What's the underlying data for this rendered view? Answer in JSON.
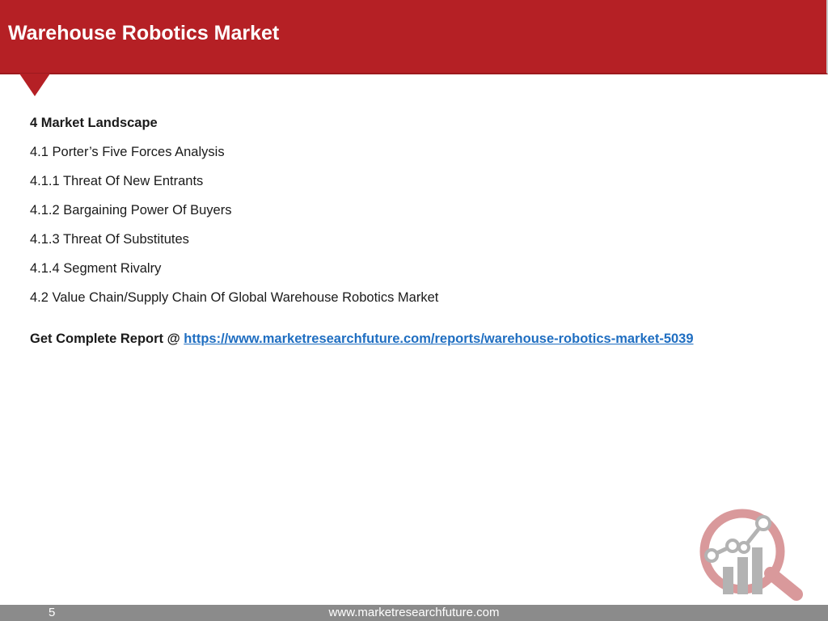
{
  "header": {
    "title": "Warehouse Robotics Market"
  },
  "toc": {
    "items": [
      {
        "text": "4 Market Landscape",
        "bold": true
      },
      {
        "text": "4.1 Porter’s Five Forces Analysis",
        "bold": false
      },
      {
        "text": "4.1.1 Threat Of New Entrants",
        "bold": false
      },
      {
        "text": "4.1.2 Bargaining Power Of Buyers",
        "bold": false
      },
      {
        "text": "4.1.3 Threat Of Substitutes",
        "bold": false
      },
      {
        "text": "4.1.4 Segment Rivalry",
        "bold": false
      },
      {
        "text": "4.2 Value Chain/Supply Chain Of Global Warehouse Robotics Market",
        "bold": false
      }
    ]
  },
  "report": {
    "prefix": "Get Complete Report @ ",
    "link_text": "https://www.marketresearchfuture.com/reports/warehouse-robotics-market-5039"
  },
  "footer": {
    "page_number": "5",
    "url": "www.marketresearchfuture.com"
  },
  "colors": {
    "brand_red": "#b52025",
    "link_blue": "#1f6ec1",
    "footer_gray": "#8b8b8b"
  },
  "icons": {
    "logo": "magnifier-chart-logo-icon"
  }
}
